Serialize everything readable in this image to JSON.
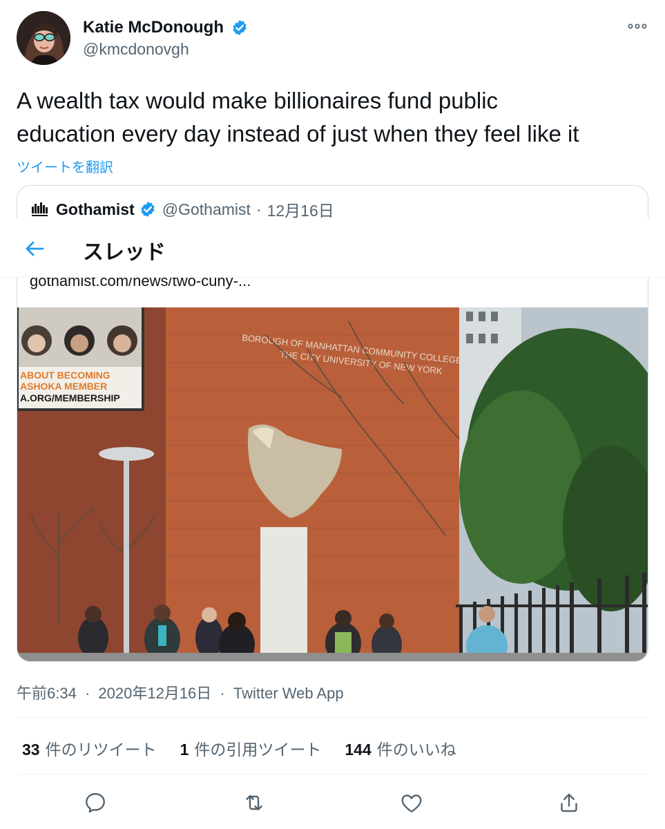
{
  "author": {
    "name": "Katie McDonough",
    "handle": "@kmcdonovgh"
  },
  "tweet": {
    "text_line1": "A wealth tax would make billionaires fund public",
    "text_line2": "education every day instead of just when they feel like it",
    "translate_label": "ツイートを翻訳"
  },
  "quoted": {
    "name": "Gothamist",
    "handle": "@Gothamist",
    "separator": "·",
    "date": "12月16日",
    "link": "gothamist.com/news/two-cuny-...",
    "image_text": {
      "billboard_line1": "ABOUT BECOMING",
      "billboard_line2": "ASHOKA MEMBER",
      "billboard_line3": "A.ORG/MEMBERSHIP",
      "building_line1": "BOROUGH OF MANHATTAN COMMUNITY COLLEGE",
      "building_line2": "THE CITY UNIVERSITY OF NEW YORK"
    }
  },
  "thread_bar": {
    "title": "スレッド"
  },
  "meta": {
    "time": "午前6:34",
    "sep1": "·",
    "date": "2020年12月16日",
    "sep2": "·",
    "source": "Twitter Web App"
  },
  "stats": {
    "retweets_count": "33",
    "retweets_label": "件のリツイート",
    "quotes_count": "1",
    "quotes_label": "件の引用ツイート",
    "likes_count": "144",
    "likes_label": "件のいいね"
  },
  "colors": {
    "accent": "#1d9bf0",
    "text": "#0f1419",
    "muted": "#536471",
    "border": "#cfd9de"
  },
  "icons": [
    "more-icon",
    "verified-icon",
    "gothamist-logo-icon",
    "back-arrow-icon",
    "reply-icon",
    "retweet-icon",
    "like-icon",
    "share-icon"
  ]
}
